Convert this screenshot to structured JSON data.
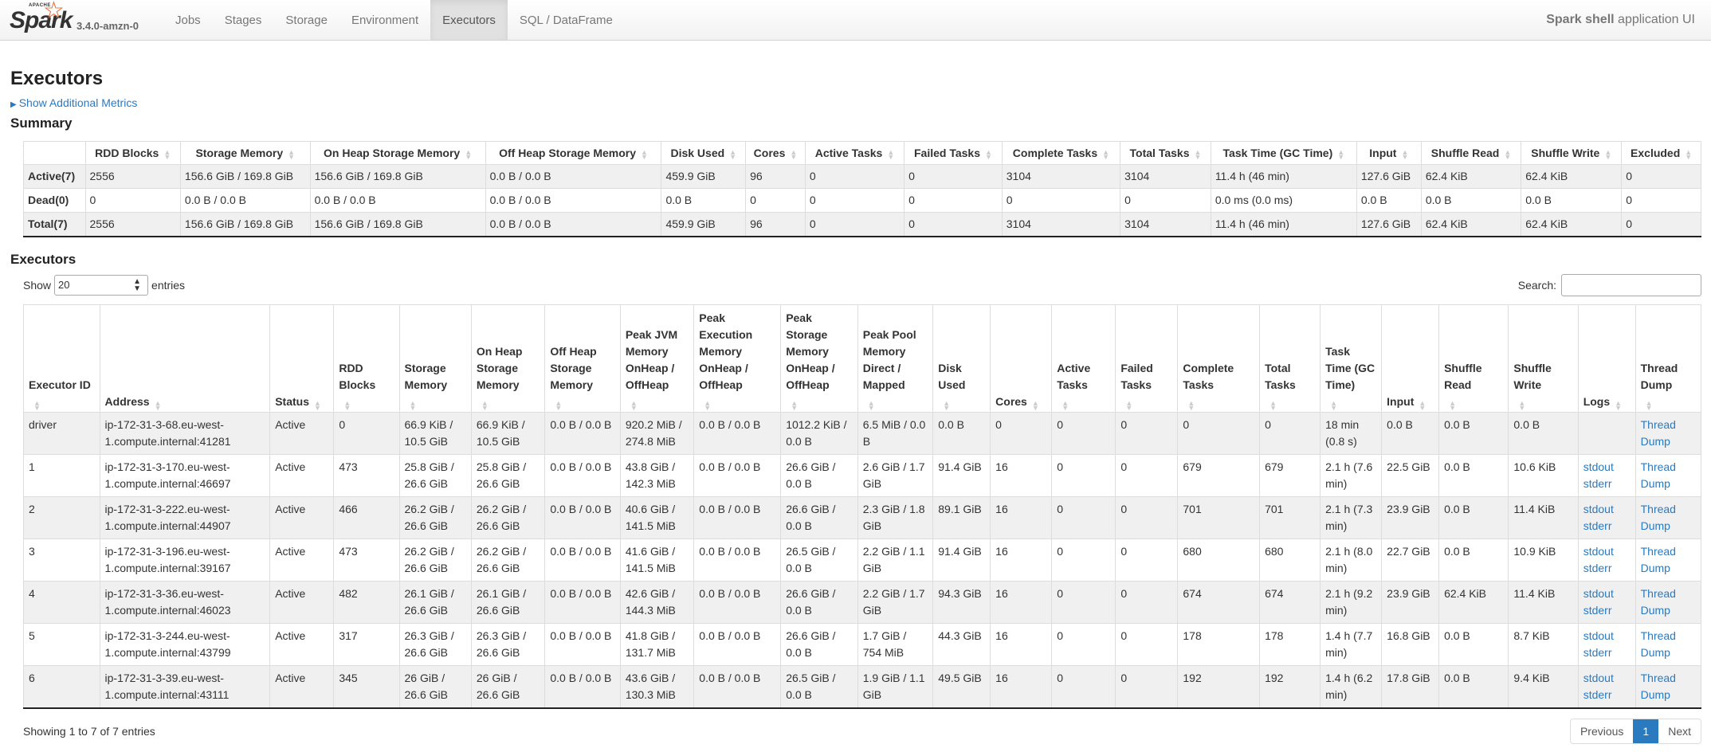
{
  "navbar": {
    "logo_small": "APACHE",
    "logo_text": "Spark",
    "version": "3.4.0-amzn-0",
    "tabs": [
      {
        "label": "Jobs",
        "active": false
      },
      {
        "label": "Stages",
        "active": false
      },
      {
        "label": "Storage",
        "active": false
      },
      {
        "label": "Environment",
        "active": false
      },
      {
        "label": "Executors",
        "active": true
      },
      {
        "label": "SQL / DataFrame",
        "active": false
      }
    ],
    "app_name": "Spark shell",
    "app_suffix": "application UI"
  },
  "page": {
    "title": "Executors",
    "additional_metrics": "Show Additional Metrics",
    "summary_heading": "Summary",
    "executors_heading": "Executors"
  },
  "summary": {
    "columns": [
      "",
      "RDD Blocks",
      "Storage Memory",
      "On Heap Storage Memory",
      "Off Heap Storage Memory",
      "Disk Used",
      "Cores",
      "Active Tasks",
      "Failed Tasks",
      "Complete Tasks",
      "Total Tasks",
      "Task Time (GC Time)",
      "Input",
      "Shuffle Read",
      "Shuffle Write",
      "Excluded"
    ],
    "rows": [
      [
        "Active(7)",
        "2556",
        "156.6 GiB / 169.8 GiB",
        "156.6 GiB / 169.8 GiB",
        "0.0 B / 0.0 B",
        "459.9 GiB",
        "96",
        "0",
        "0",
        "3104",
        "3104",
        "11.4 h (46 min)",
        "127.6 GiB",
        "62.4 KiB",
        "62.4 KiB",
        "0"
      ],
      [
        "Dead(0)",
        "0",
        "0.0 B / 0.0 B",
        "0.0 B / 0.0 B",
        "0.0 B / 0.0 B",
        "0.0 B",
        "0",
        "0",
        "0",
        "0",
        "0",
        "0.0 ms (0.0 ms)",
        "0.0 B",
        "0.0 B",
        "0.0 B",
        "0"
      ],
      [
        "Total(7)",
        "2556",
        "156.6 GiB / 169.8 GiB",
        "156.6 GiB / 169.8 GiB",
        "0.0 B / 0.0 B",
        "459.9 GiB",
        "96",
        "0",
        "0",
        "3104",
        "3104",
        "11.4 h (46 min)",
        "127.6 GiB",
        "62.4 KiB",
        "62.4 KiB",
        "0"
      ]
    ]
  },
  "controls": {
    "show_label": "Show",
    "page_size": "20",
    "entries_label": "entries",
    "search_label": "Search:",
    "search_value": ""
  },
  "executors": {
    "columns": [
      "Executor ID",
      "Address",
      "Status",
      "RDD Blocks",
      "Storage Memory",
      "On Heap Storage Memory",
      "Off Heap Storage Memory",
      "Peak JVM Memory OnHeap / OffHeap",
      "Peak Execution Memory OnHeap / OffHeap",
      "Peak Storage Memory OnHeap / OffHeap",
      "Peak Pool Memory Direct / Mapped",
      "Disk Used",
      "Cores",
      "Active Tasks",
      "Failed Tasks",
      "Complete Tasks",
      "Total Tasks",
      "Task Time (GC Time)",
      "Input",
      "Shuffle Read",
      "Shuffle Write",
      "Logs",
      "Thread Dump"
    ],
    "rows": [
      {
        "id": "driver",
        "address": "ip-172-31-3-68.eu-west-1.compute.internal:41281",
        "status": "Active",
        "rdd_blocks": "0",
        "storage_memory": "66.9 KiB / 10.5 GiB",
        "on_heap": "66.9 KiB / 10.5 GiB",
        "off_heap": "0.0 B / 0.0 B",
        "peak_jvm": "920.2 MiB / 274.8 MiB",
        "peak_exec": "0.0 B / 0.0 B",
        "peak_storage": "1012.2 KiB / 0.0 B",
        "peak_pool": "6.5 MiB / 0.0 B",
        "disk_used": "0.0 B",
        "cores": "0",
        "active_tasks": "0",
        "failed_tasks": "0",
        "complete_tasks": "0",
        "total_tasks": "0",
        "task_time": "18 min (0.8 s)",
        "input": "0.0 B",
        "shuffle_read": "0.0 B",
        "shuffle_write": "0.0 B",
        "logs": [],
        "thread_dump": "Thread Dump"
      },
      {
        "id": "1",
        "address": "ip-172-31-3-170.eu-west-1.compute.internal:46697",
        "status": "Active",
        "rdd_blocks": "473",
        "storage_memory": "25.8 GiB / 26.6 GiB",
        "on_heap": "25.8 GiB / 26.6 GiB",
        "off_heap": "0.0 B / 0.0 B",
        "peak_jvm": "43.8 GiB / 142.3 MiB",
        "peak_exec": "0.0 B / 0.0 B",
        "peak_storage": "26.6 GiB / 0.0 B",
        "peak_pool": "2.6 GiB / 1.7 GiB",
        "disk_used": "91.4 GiB",
        "cores": "16",
        "active_tasks": "0",
        "failed_tasks": "0",
        "complete_tasks": "679",
        "total_tasks": "679",
        "task_time": "2.1 h (7.6 min)",
        "input": "22.5 GiB",
        "shuffle_read": "0.0 B",
        "shuffle_write": "10.6 KiB",
        "logs": [
          "stdout",
          "stderr"
        ],
        "thread_dump": "Thread Dump"
      },
      {
        "id": "2",
        "address": "ip-172-31-3-222.eu-west-1.compute.internal:44907",
        "status": "Active",
        "rdd_blocks": "466",
        "storage_memory": "26.2 GiB / 26.6 GiB",
        "on_heap": "26.2 GiB / 26.6 GiB",
        "off_heap": "0.0 B / 0.0 B",
        "peak_jvm": "40.6 GiB / 141.5 MiB",
        "peak_exec": "0.0 B / 0.0 B",
        "peak_storage": "26.6 GiB / 0.0 B",
        "peak_pool": "2.3 GiB / 1.8 GiB",
        "disk_used": "89.1 GiB",
        "cores": "16",
        "active_tasks": "0",
        "failed_tasks": "0",
        "complete_tasks": "701",
        "total_tasks": "701",
        "task_time": "2.1 h (7.3 min)",
        "input": "23.9 GiB",
        "shuffle_read": "0.0 B",
        "shuffle_write": "11.4 KiB",
        "logs": [
          "stdout",
          "stderr"
        ],
        "thread_dump": "Thread Dump"
      },
      {
        "id": "3",
        "address": "ip-172-31-3-196.eu-west-1.compute.internal:39167",
        "status": "Active",
        "rdd_blocks": "473",
        "storage_memory": "26.2 GiB / 26.6 GiB",
        "on_heap": "26.2 GiB / 26.6 GiB",
        "off_heap": "0.0 B / 0.0 B",
        "peak_jvm": "41.6 GiB / 141.5 MiB",
        "peak_exec": "0.0 B / 0.0 B",
        "peak_storage": "26.5 GiB / 0.0 B",
        "peak_pool": "2.2 GiB / 1.1 GiB",
        "disk_used": "91.4 GiB",
        "cores": "16",
        "active_tasks": "0",
        "failed_tasks": "0",
        "complete_tasks": "680",
        "total_tasks": "680",
        "task_time": "2.1 h (8.0 min)",
        "input": "22.7 GiB",
        "shuffle_read": "0.0 B",
        "shuffle_write": "10.9 KiB",
        "logs": [
          "stdout",
          "stderr"
        ],
        "thread_dump": "Thread Dump"
      },
      {
        "id": "4",
        "address": "ip-172-31-3-36.eu-west-1.compute.internal:46023",
        "status": "Active",
        "rdd_blocks": "482",
        "storage_memory": "26.1 GiB / 26.6 GiB",
        "on_heap": "26.1 GiB / 26.6 GiB",
        "off_heap": "0.0 B / 0.0 B",
        "peak_jvm": "42.6 GiB / 144.3 MiB",
        "peak_exec": "0.0 B / 0.0 B",
        "peak_storage": "26.6 GiB / 0.0 B",
        "peak_pool": "2.2 GiB / 1.7 GiB",
        "disk_used": "94.3 GiB",
        "cores": "16",
        "active_tasks": "0",
        "failed_tasks": "0",
        "complete_tasks": "674",
        "total_tasks": "674",
        "task_time": "2.1 h (9.2 min)",
        "input": "23.9 GiB",
        "shuffle_read": "62.4 KiB",
        "shuffle_write": "11.4 KiB",
        "logs": [
          "stdout",
          "stderr"
        ],
        "thread_dump": "Thread Dump"
      },
      {
        "id": "5",
        "address": "ip-172-31-3-244.eu-west-1.compute.internal:43799",
        "status": "Active",
        "rdd_blocks": "317",
        "storage_memory": "26.3 GiB / 26.6 GiB",
        "on_heap": "26.3 GiB / 26.6 GiB",
        "off_heap": "0.0 B / 0.0 B",
        "peak_jvm": "41.8 GiB / 131.7 MiB",
        "peak_exec": "0.0 B / 0.0 B",
        "peak_storage": "26.6 GiB / 0.0 B",
        "peak_pool": "1.7 GiB / 754 MiB",
        "disk_used": "44.3 GiB",
        "cores": "16",
        "active_tasks": "0",
        "failed_tasks": "0",
        "complete_tasks": "178",
        "total_tasks": "178",
        "task_time": "1.4 h (7.7 min)",
        "input": "16.8 GiB",
        "shuffle_read": "0.0 B",
        "shuffle_write": "8.7 KiB",
        "logs": [
          "stdout",
          "stderr"
        ],
        "thread_dump": "Thread Dump"
      },
      {
        "id": "6",
        "address": "ip-172-31-3-39.eu-west-1.compute.internal:43111",
        "status": "Active",
        "rdd_blocks": "345",
        "storage_memory": "26 GiB / 26.6 GiB",
        "on_heap": "26 GiB / 26.6 GiB",
        "off_heap": "0.0 B / 0.0 B",
        "peak_jvm": "43.6 GiB / 130.3 MiB",
        "peak_exec": "0.0 B / 0.0 B",
        "peak_storage": "26.5 GiB / 0.0 B",
        "peak_pool": "1.9 GiB / 1.1 GiB",
        "disk_used": "49.5 GiB",
        "cores": "16",
        "active_tasks": "0",
        "failed_tasks": "0",
        "complete_tasks": "192",
        "total_tasks": "192",
        "task_time": "1.4 h (6.2 min)",
        "input": "17.8 GiB",
        "shuffle_read": "0.0 B",
        "shuffle_write": "9.4 KiB",
        "logs": [
          "stdout",
          "stderr"
        ],
        "thread_dump": "Thread Dump"
      }
    ]
  },
  "footer": {
    "info": "Showing 1 to 7 of 7 entries",
    "previous": "Previous",
    "current_page": "1",
    "next": "Next"
  },
  "colors": {
    "link": "#2a7ac0",
    "active_page": "#2a7ac0",
    "logo_star": "#e25a1c"
  }
}
